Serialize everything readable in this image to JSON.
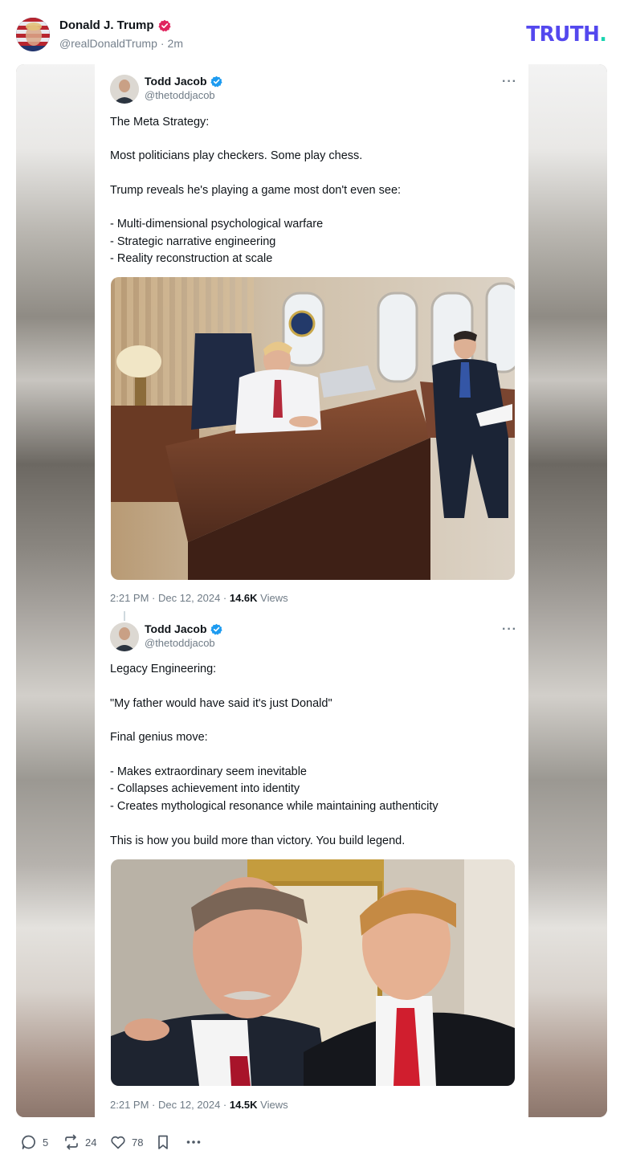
{
  "post": {
    "author_name": "Donald J. Trump",
    "handle": "@realDonaldTrump",
    "separator": "·",
    "time": "2m",
    "brand": "TRUTH",
    "brand_dot": "."
  },
  "tweets": [
    {
      "name": "Todd Jacob",
      "handle": "@thetoddjacob",
      "more": "···",
      "lines": [
        "The Meta Strategy:",
        "Most politicians play checkers. Some play chess.",
        "Trump reveals he's playing a game most don't even see:",
        "- Multi-dimensional psychological warfare",
        "- Strategic narrative engineering",
        "- Reality reconstruction at scale"
      ],
      "timestamp": "2:21 PM · Dec 12, 2024 · ",
      "views_count": "14.6K",
      "views_label": " Views"
    },
    {
      "name": "Todd Jacob",
      "handle": "@thetoddjacob",
      "more": "···",
      "lines": [
        "Legacy Engineering:",
        "\"My father would have said it's just Donald\"",
        "Final genius move:",
        "- Makes extraordinary seem inevitable",
        "- Collapses achievement into identity",
        "- Creates mythological resonance while maintaining authenticity",
        "This is how you build more than victory. You build legend."
      ],
      "timestamp": "2:21 PM · Dec 12, 2024 · ",
      "views_count": "14.5K",
      "views_label": " Views"
    }
  ],
  "actions": {
    "replies": "5",
    "retruths": "24",
    "likes": "78"
  },
  "colors": {
    "brand": "#5448ee",
    "brand_dot": "#18d4b0",
    "verified_blue": "#1d9bf0",
    "verified_red": "#e0245e",
    "muted": "#75808c"
  },
  "icons": [
    "reply-icon",
    "retruth-icon",
    "like-icon",
    "bookmark-icon",
    "more-icon",
    "verified-badge-icon"
  ]
}
